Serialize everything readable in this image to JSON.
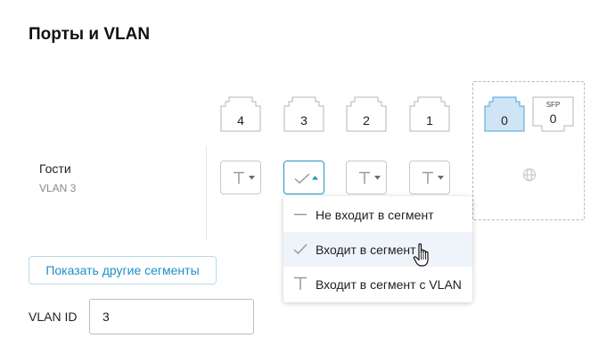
{
  "page": {
    "title": "Порты и VLAN"
  },
  "segment": {
    "name": "Гости",
    "vlan_label": "VLAN 3"
  },
  "ports": [
    {
      "number": "4"
    },
    {
      "number": "3"
    },
    {
      "number": "2"
    },
    {
      "number": "1"
    }
  ],
  "wan": {
    "ethernet_port": {
      "number": "0",
      "selected": true
    },
    "sfp_port": {
      "label": "SFP",
      "number": "0"
    }
  },
  "port_modes": [
    {
      "port": "4",
      "mode": "tagged",
      "active": false
    },
    {
      "port": "3",
      "mode": "untagged",
      "active": true
    },
    {
      "port": "2",
      "mode": "tagged",
      "active": false
    },
    {
      "port": "1",
      "mode": "tagged",
      "active": false
    }
  ],
  "dropdown": {
    "items": [
      {
        "label": "Не входит в сегмент",
        "icon": "dash-icon"
      },
      {
        "label": "Входит в сегмент",
        "icon": "check-icon",
        "hovered": true
      },
      {
        "label": "Входит в сегмент с VLAN",
        "icon": "t-icon"
      }
    ]
  },
  "show_other_segments_button": "Показать другие сегменты",
  "vlan_id": {
    "label": "VLAN ID",
    "value": "3"
  },
  "colors": {
    "accent": "#1f97c4",
    "link": "#1f8fc4",
    "selected_port_fill": "#cfe5f5",
    "selected_port_stroke": "#4aa3d8",
    "hover_bg": "#eef4f9",
    "icon_gray": "#9a9a9a"
  }
}
